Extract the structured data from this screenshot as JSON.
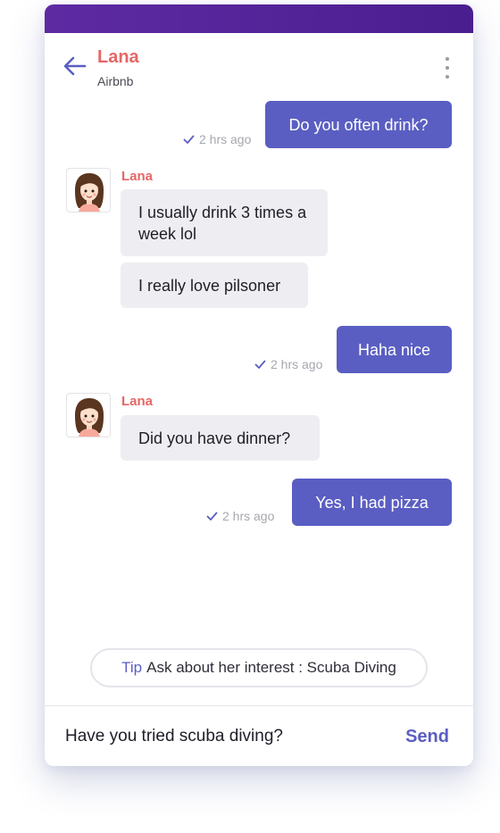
{
  "colors": {
    "primary": "#5a5ec2",
    "header_gradient_start": "#5e2aa3",
    "header_gradient_end": "#4a1e8f",
    "contact_name": "#e66666",
    "bubble_incoming": "#eeeef2"
  },
  "header": {
    "back_icon": "arrow-left-icon",
    "contact_name": "Lana",
    "contact_subtitle": "Airbnb",
    "menu_icon": "more-vertical-icon"
  },
  "messages": [
    {
      "direction": "outgoing",
      "text": "Do you often drink?",
      "time": "2 hrs ago",
      "status_icon": "check-icon"
    },
    {
      "direction": "incoming",
      "sender": "Lana",
      "text": "I usually drink 3 times a week lol"
    },
    {
      "direction": "incoming",
      "text": "I really love pilsoner"
    },
    {
      "direction": "outgoing",
      "text": "Haha nice",
      "time": "2 hrs ago",
      "status_icon": "check-icon"
    },
    {
      "direction": "incoming",
      "sender": "Lana",
      "text": "Did you have dinner?"
    },
    {
      "direction": "outgoing",
      "text": "Yes, I had pizza",
      "time": "2 hrs ago",
      "status_icon": "check-icon"
    }
  ],
  "tip": {
    "label": "Tip",
    "text": "Ask about her interest : Scuba Diving"
  },
  "composer": {
    "value": "Have you tried scuba diving?",
    "send_label": "Send"
  }
}
